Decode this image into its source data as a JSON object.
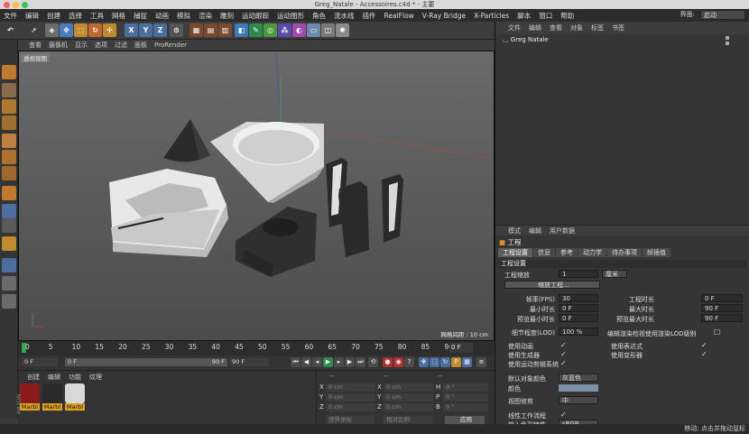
{
  "window": {
    "title": "Greg_Natale - Accessoires.c4d * - 主要"
  },
  "menubar": {
    "items": [
      "文件",
      "编辑",
      "创建",
      "选择",
      "工具",
      "网格",
      "捕捉",
      "动画",
      "模拟",
      "渲染",
      "雕刻",
      "运动跟踪",
      "运动图形",
      "角色",
      "流水线",
      "插件",
      "RealFlow",
      "V-Ray Bridge",
      "X-Particles",
      "脚本",
      "窗口",
      "帮助"
    ],
    "layout_label": "界面:",
    "layout_value": "启动"
  },
  "viewport": {
    "menu": [
      "查看",
      "摄像机",
      "显示",
      "选项",
      "过滤",
      "面板",
      "ProRender"
    ],
    "label": "透视视图",
    "grid_spacing": "网格间距 : 10 cm"
  },
  "timeline": {
    "ticks": [
      "0",
      "5",
      "10",
      "15",
      "20",
      "25",
      "30",
      "35",
      "40",
      "45",
      "50",
      "55",
      "60",
      "65",
      "70",
      "75",
      "80",
      "85",
      "90"
    ],
    "frame_end": "0 F"
  },
  "playback": {
    "current": "0 F",
    "start": "0 F",
    "end": "90 F",
    "end2": "90 F"
  },
  "material_panel": {
    "menu": [
      "创建",
      "编辑",
      "功能",
      "纹理"
    ],
    "materials": [
      "Marbl",
      "Marbl",
      "Marbl"
    ]
  },
  "coord_panel": {
    "header": [
      "--",
      "--",
      "--"
    ],
    "rows": [
      {
        "axis": "X",
        "pos": "0 cm",
        "size": "0 cm",
        "rot_label": "H",
        "rot": "0 °"
      },
      {
        "axis": "Y",
        "pos": "0 cm",
        "size": "0 cm",
        "rot_label": "P",
        "rot": "0 °"
      },
      {
        "axis": "Z",
        "pos": "0 cm",
        "size": "0 cm",
        "rot_label": "B",
        "rot": "0 °"
      }
    ],
    "coord_mode": "世界坐标",
    "size_mode": "相对比例",
    "apply": "应用"
  },
  "object_manager": {
    "menu": [
      "文件",
      "编辑",
      "查看",
      "对象",
      "标签",
      "书签"
    ],
    "object": "Greg Natale"
  },
  "attribute_manager": {
    "menu": [
      "模式",
      "编辑",
      "用户数据"
    ],
    "title": "工程",
    "tabs": [
      "工程设置",
      "信息",
      "参考",
      "动力学",
      "待办事项",
      "帧插值"
    ],
    "section": "工程设置",
    "scale_label": "工程缩放",
    "scale_value": "1",
    "scale_unit": "厘米",
    "scale_button": "缩放工程...",
    "fields_left": [
      {
        "label": "帧率(FPS)",
        "value": "30"
      },
      {
        "label": "最小时长",
        "value": "0 F"
      },
      {
        "label": "预览最小时长",
        "value": "0 F"
      },
      {
        "label": "细节程度(LOD)",
        "value": "100 %"
      }
    ],
    "fields_right": [
      {
        "label": "工程时长",
        "value": "0 F"
      },
      {
        "label": "最大时长",
        "value": "90 F"
      },
      {
        "label": "预览最大时长",
        "value": "90 F"
      }
    ],
    "lod_check": "编辑渲染检视使用渲染LOD级别",
    "checks_left": [
      "使用动画",
      "使用生成器",
      "使用运动剪辑系统"
    ],
    "checks_right": [
      "使用表达式",
      "使用变形器"
    ],
    "default_color_label": "默认对象颜色",
    "default_color_value": "灰蓝色",
    "color_label": "颜色",
    "view_clip_label": "视图修剪",
    "view_clip_value": "中",
    "linear_label": "线性工作流程",
    "input_color_label": "输入色彩特性",
    "input_color_value": "sRGB"
  },
  "statusbar": {
    "text": "移动: 点击并拖动鼠标"
  }
}
